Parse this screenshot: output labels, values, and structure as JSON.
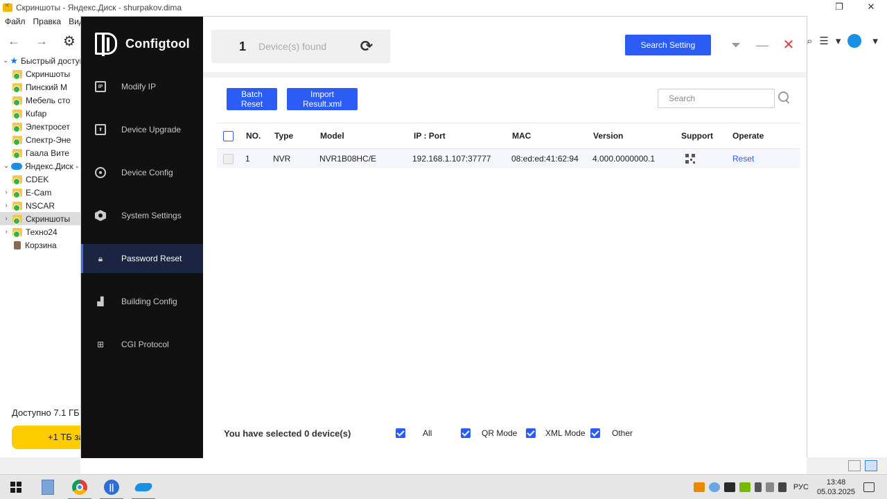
{
  "background_window": {
    "title": "Скриншоты - Яндекс.Диск - shurpakov.dima",
    "menu": [
      "Файл",
      "Правка",
      "Вид"
    ],
    "tree": [
      {
        "label": "Быстрый доступ",
        "kind": "star",
        "expanded": true
      },
      {
        "label": "Скриншоты",
        "kind": "folder"
      },
      {
        "label": "Пинский М",
        "kind": "folder"
      },
      {
        "label": "Мебель сто",
        "kind": "folder"
      },
      {
        "label": "Кufар",
        "kind": "folder"
      },
      {
        "label": "Электросет",
        "kind": "folder"
      },
      {
        "label": "Спектр-Эне",
        "kind": "folder"
      },
      {
        "label": "Гаала Вите",
        "kind": "folder"
      },
      {
        "label": "Яндекс.Диск -",
        "kind": "cloud",
        "expanded": true
      },
      {
        "label": "CDEK",
        "kind": "folder"
      },
      {
        "label": "E-Cam",
        "kind": "folder",
        "collapsed": true
      },
      {
        "label": "NSCAR",
        "kind": "folder",
        "collapsed": true
      },
      {
        "label": "Скриншоты",
        "kind": "folder",
        "collapsed": true,
        "selected": true
      },
      {
        "label": "Техно24",
        "kind": "folder",
        "collapsed": true
      },
      {
        "label": "Корзина",
        "kind": "bin"
      }
    ],
    "available": "Доступно 7.1 ГБ",
    "promo": "+1 ТБ за"
  },
  "app": {
    "name": "Configtool",
    "nav": [
      {
        "label": "Modify IP",
        "icon": "ip-icon"
      },
      {
        "label": "Device Upgrade",
        "icon": "upgrade-icon"
      },
      {
        "label": "Device Config",
        "icon": "config-icon"
      },
      {
        "label": "System Settings",
        "icon": "settings-icon"
      },
      {
        "label": "Password Reset",
        "icon": "lock-icon",
        "active": true
      },
      {
        "label": "Building Config",
        "icon": "building-icon"
      },
      {
        "label": "CGI Protocol",
        "icon": "cgi-icon"
      }
    ],
    "ip_badge": "IP"
  },
  "header": {
    "found_count": "1",
    "found_label": "Device(s) found",
    "search_setting": "Search Setting"
  },
  "toolbar": {
    "batch_reset": "Batch Reset",
    "import_result": "Import Result.xml",
    "search_placeholder": "Search"
  },
  "table": {
    "columns": [
      "NO.",
      "Type",
      "Model",
      "IP : Port",
      "MAC",
      "Version",
      "Support",
      "Operate"
    ],
    "rows": [
      {
        "no": "1",
        "type": "NVR",
        "model": "NVR1B08HC/E",
        "ip_port": "192.168.1.107:37777",
        "mac": "08:ed:ed:41:62:94",
        "version": "4.000.0000000.1",
        "operate": "Reset"
      }
    ]
  },
  "footer": {
    "selected_text": "You have selected 0  device(s)",
    "filters": [
      "All",
      "QR Mode",
      "XML Mode",
      "Other"
    ]
  },
  "taskbar": {
    "lang": "РУС",
    "time": "13:48",
    "date": "05.03.2025"
  },
  "colors": {
    "accent": "#2b5cf5",
    "sidebar": "#111111",
    "active_nav": "#1b2440",
    "close": "#e03c3c"
  }
}
